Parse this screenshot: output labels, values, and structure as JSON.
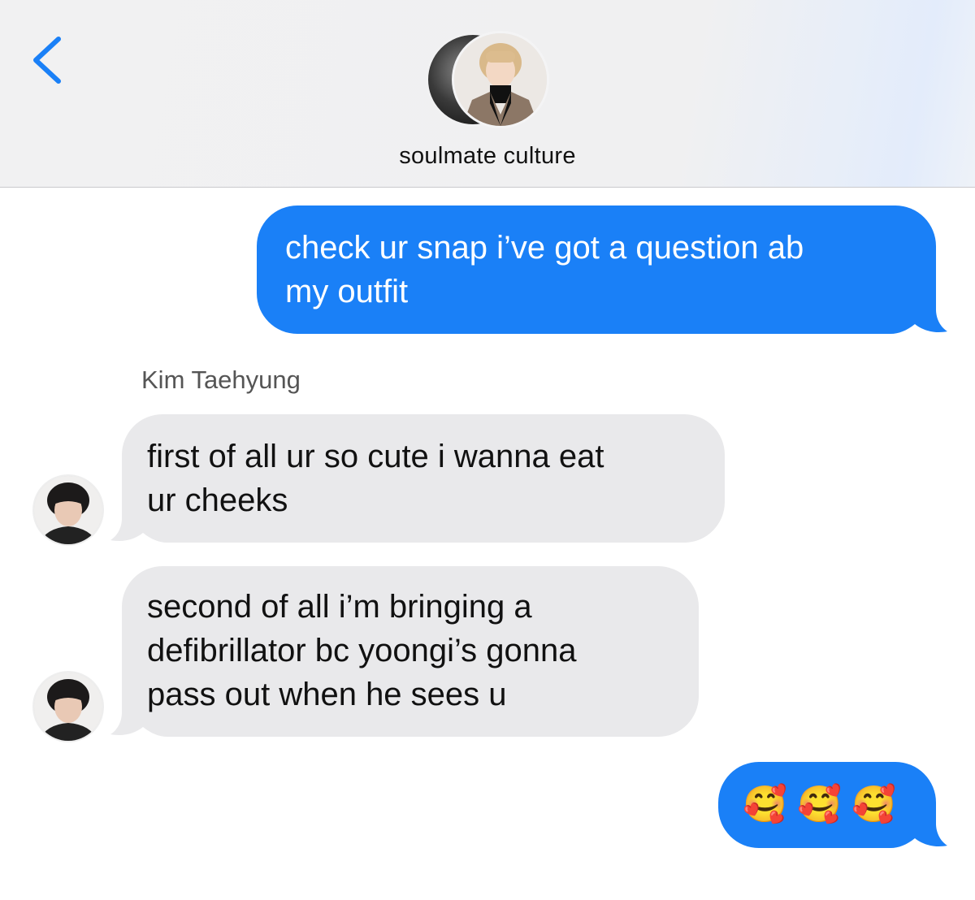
{
  "header": {
    "back_icon": "chevron-left-icon",
    "thread_name": "soulmate culture",
    "accent": "#1a80f7"
  },
  "messages": [
    {
      "direction": "outgoing",
      "text": "check ur snap i’ve got a question ab my outfit",
      "lines": [
        "check ur snap i’ve got a question ab",
        "my outfit"
      ]
    },
    {
      "direction": "incoming",
      "sender": "Kim Taehyung",
      "lines": [
        "first of all ur so cute i wanna eat",
        "ur cheeks"
      ]
    },
    {
      "direction": "incoming",
      "lines": [
        "second of all i’m bringing a",
        "defibrillator bc yoongi’s gonna",
        "pass out when he sees u"
      ]
    },
    {
      "direction": "outgoing",
      "emoji": "🥰 🥰 🥰"
    }
  ],
  "colors": {
    "outgoing_bubble": "#1a80f7",
    "incoming_bubble": "#e9e9eb"
  }
}
